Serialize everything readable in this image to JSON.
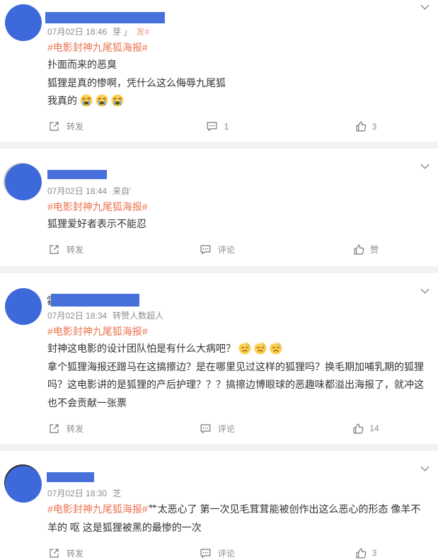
{
  "colors": {
    "avatar": "#3d69da",
    "name_redaction": "#4770db",
    "hashtag": "#eb7350",
    "text": "#333333",
    "meta": "#8c8c8c",
    "separator": "#f2f2f2"
  },
  "icons": {
    "menu": "chevron-down-icon",
    "repost": "repost-icon",
    "comment": "comment-icon",
    "like": "like-icon"
  },
  "posts": [
    {
      "time": "07月02日 18:46",
      "source": "芽 」",
      "source_tag": "发#",
      "hashtag": "#电影封神九尾狐海报#",
      "lines": [
        "扑面而来的恶臭",
        "狐狸是真的惨啊，凭什么这么侮辱九尾狐",
        "我真的"
      ],
      "emoji": [
        "crying-face",
        "crying-face",
        "crying-face"
      ],
      "actions": {
        "repost": "转发",
        "comment": "1",
        "like": "3"
      }
    },
    {
      "time": "07月02日 18:44",
      "source": "来自'",
      "hashtag": "#电影封神九尾狐海报#",
      "lines": [
        "狐狸爱好者表示不能忍"
      ],
      "actions": {
        "repost": "转发",
        "comment": "评论",
        "like": "赞"
      }
    },
    {
      "name_prefix": "霍",
      "time": "07月02日 18:34",
      "source": "转赞人数超人",
      "hashtag": "#电影封神九尾狐海报#",
      "lines": [
        "封神这电影的设计团队怕是有什么大病吧？",
        "拿个狐狸海报还蹭马在这搞擦边？是在哪里见过这样的狐狸吗？换毛期加哺乳期的狐狸",
        "吗？这电影讲的是狐狸的产后护理？？？搞擦边博眼球的恶趣味都溢出海报了，就冲这",
        "也不会贡献一张票"
      ],
      "emoji": [
        "sweat-face",
        "sweat-face",
        "sweat-face"
      ],
      "actions": {
        "repost": "转发",
        "comment": "评论",
        "like": "14"
      }
    },
    {
      "time": "07月02日 18:30",
      "source": "芝",
      "hashtag": "#电影封神九尾狐海报#",
      "lines": [
        "艹太恶心了 第一次见毛茸茸能被创作出这么恶心的形态 像羊不",
        "羊的 呕 这是狐狸被黑的最惨的一次"
      ],
      "actions": {
        "repost": "转发",
        "comment": "评论",
        "like": "3"
      }
    }
  ]
}
